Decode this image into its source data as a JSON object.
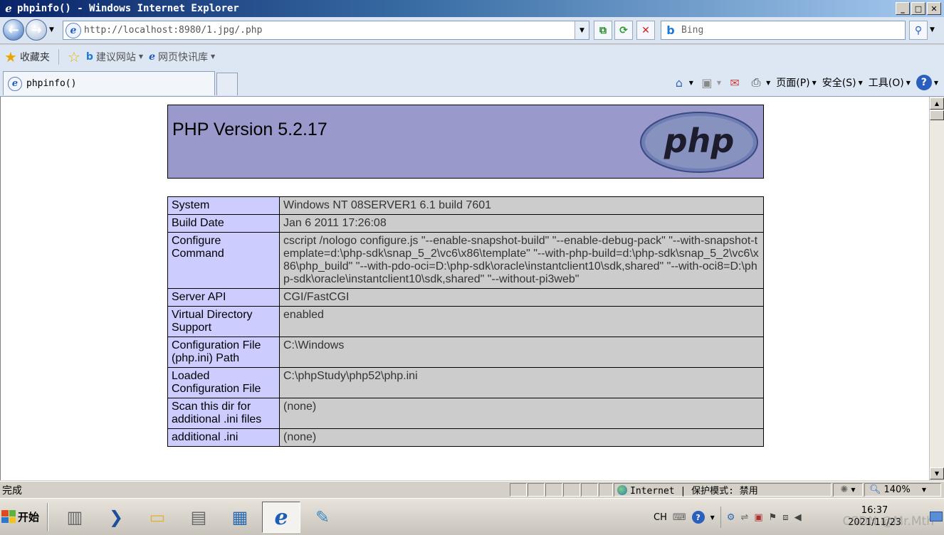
{
  "window": {
    "title": "phpinfo() - Windows Internet Explorer",
    "btn_min": "_",
    "btn_max": "□",
    "btn_close": "✕"
  },
  "nav": {
    "address": "http://localhost:8980/1.jpg/.php",
    "search_placeholder": "Bing"
  },
  "favorites": {
    "label": "收藏夹",
    "suggested": "建议网站",
    "webslice": "网页快讯库"
  },
  "tab": {
    "title": "phpinfo()"
  },
  "commands": {
    "page": "页面(P)",
    "safety": "安全(S)",
    "tools": "工具(O)"
  },
  "php": {
    "title": "PHP Version 5.2.17",
    "logo_text": "php",
    "rows": [
      {
        "key": "System",
        "value": "Windows NT 08SERVER1 6.1 build 7601"
      },
      {
        "key": "Build Date",
        "value": "Jan 6 2011 17:26:08"
      },
      {
        "key": "Configure Command",
        "value": "cscript /nologo configure.js \"--enable-snapshot-build\" \"--enable-debug-pack\" \"--with-snapshot-template=d:\\php-sdk\\snap_5_2\\vc6\\x86\\template\" \"--with-php-build=d:\\php-sdk\\snap_5_2\\vc6\\x86\\php_build\" \"--with-pdo-oci=D:\\php-sdk\\oracle\\instantclient10\\sdk,shared\" \"--with-oci8=D:\\php-sdk\\oracle\\instantclient10\\sdk,shared\" \"--without-pi3web\""
      },
      {
        "key": "Server API",
        "value": "CGI/FastCGI"
      },
      {
        "key": "Virtual Directory Support",
        "value": "enabled"
      },
      {
        "key": "Configuration File (php.ini) Path",
        "value": "C:\\Windows"
      },
      {
        "key": "Loaded Configuration File",
        "value": "C:\\phpStudy\\php52\\php.ini"
      },
      {
        "key": "Scan this dir for additional .ini files",
        "value": "(none)"
      },
      {
        "key": "additional .ini",
        "value": "(none)"
      }
    ]
  },
  "status": {
    "text": "完成",
    "zone": "Internet | 保护模式: 禁用",
    "zoom": "140%"
  },
  "taskbar": {
    "start": "开始",
    "lang": "CH",
    "time": "16:37",
    "date": "2021/11/23",
    "watermark": "CSDN @Mr.Mth"
  }
}
